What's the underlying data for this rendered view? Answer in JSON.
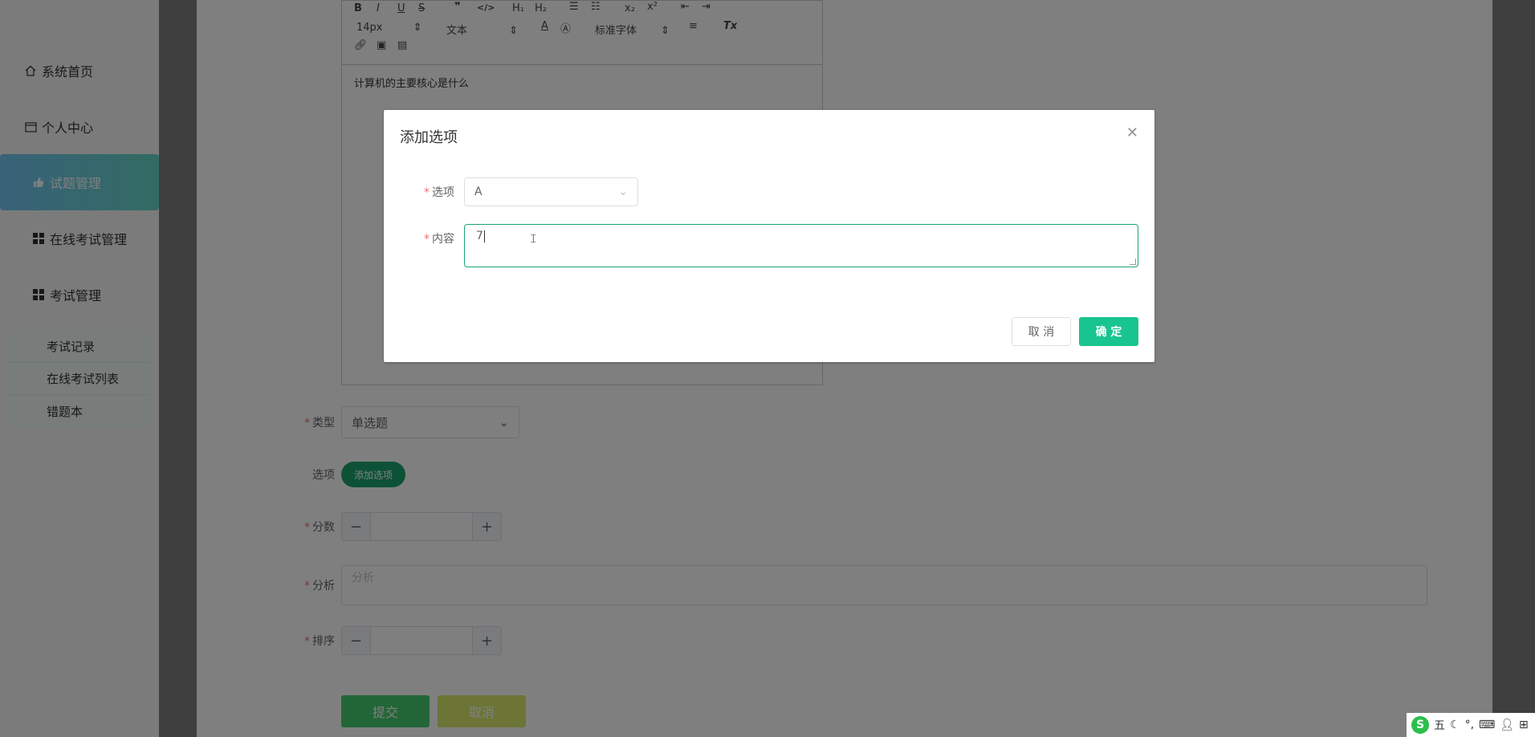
{
  "sidebar": {
    "items": [
      {
        "label": "系统首页",
        "icon": "home-icon"
      },
      {
        "label": "个人中心",
        "icon": "card-icon"
      },
      {
        "label": "试题管理",
        "icon": "thumb-icon"
      },
      {
        "label": "在线考试管理",
        "icon": "grid-icon"
      },
      {
        "label": "考试管理",
        "icon": "grid-icon"
      }
    ],
    "submenu": [
      "考试记录",
      "在线考试列表",
      "错题本"
    ]
  },
  "editor": {
    "font_size": "14px",
    "block_type": "文本",
    "font_family": "标准字体",
    "content": "计算机的主要核心是什么"
  },
  "form": {
    "type_label": "类型",
    "type_value": "单选题",
    "options_label": "选项",
    "add_option_label": "添加选项",
    "score_label": "分数",
    "analysis_label": "分析",
    "analysis_placeholder": "分析",
    "order_label": "排序",
    "submit_label": "提交",
    "cancel_label": "取消"
  },
  "dialog": {
    "title": "添加选项",
    "option_label": "选项",
    "option_value": "A",
    "content_label": "内容",
    "content_value": "7",
    "cancel_label": "取 消",
    "ok_label": "确 定"
  },
  "tray": {
    "ime_mode": "五"
  },
  "colors": {
    "accent": "#18c48f",
    "sidebar_active": "#72c4f2",
    "required": "#f56c6c"
  }
}
